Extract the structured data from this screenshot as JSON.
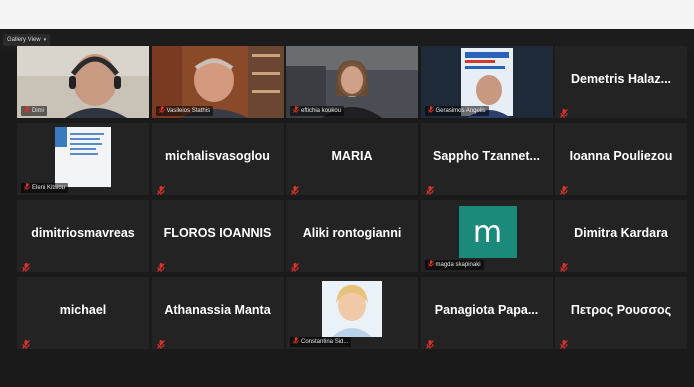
{
  "toolbar": {
    "view_label": "Gallery View",
    "caret": "▾"
  },
  "participants": [
    {
      "name": "Dimi",
      "label": "Dimi",
      "type": "video-man-headset"
    },
    {
      "name": "Vasileios Stathis",
      "label": "Vasileios Stathis",
      "type": "video-man-shelves"
    },
    {
      "name": "eftichia koukou",
      "label": "eftichia koukou",
      "type": "video-woman"
    },
    {
      "name": "Gerasimos Angelis",
      "label": "Gerasimos Angelis",
      "type": "video-man-banner",
      "active": true
    },
    {
      "name": "Demetris Halaz...",
      "type": "name-only"
    },
    {
      "name": "Eleni Kitsiou",
      "label": "Eleni Kitsiou",
      "type": "book-cover"
    },
    {
      "name": "michalisvasoglou",
      "type": "name-only"
    },
    {
      "name": "MARIA",
      "type": "name-only"
    },
    {
      "name": "Sappho Tzannet...",
      "type": "name-only"
    },
    {
      "name": "Ioanna Pouliezou",
      "type": "name-only"
    },
    {
      "name": "dimitriosmavreas",
      "type": "name-only"
    },
    {
      "name": "FLOROS IOANNIS",
      "type": "name-only"
    },
    {
      "name": "Aliki rontogianni",
      "type": "name-only"
    },
    {
      "name": "magda skapinaki",
      "label": "magda skapinaki",
      "type": "avatar-m",
      "avatar": "m"
    },
    {
      "name": "Dimitra Kardara",
      "type": "name-only"
    },
    {
      "name": "michael",
      "type": "name-only"
    },
    {
      "name": "Athanassia Manta",
      "type": "name-only"
    },
    {
      "name": "Constantina Sid...",
      "label": "Constantina Sid...",
      "type": "photo-woman"
    },
    {
      "name": "Panagiota Papa...",
      "type": "name-only"
    },
    {
      "name": "Πετρος Ρουσσος",
      "type": "name-only"
    }
  ],
  "colors": {
    "background": "#1a1a1a",
    "tile": "#232323",
    "active_border": "#b8d23a",
    "mic_muted": "#e0312b",
    "avatar_m": "#1b8a7a"
  }
}
